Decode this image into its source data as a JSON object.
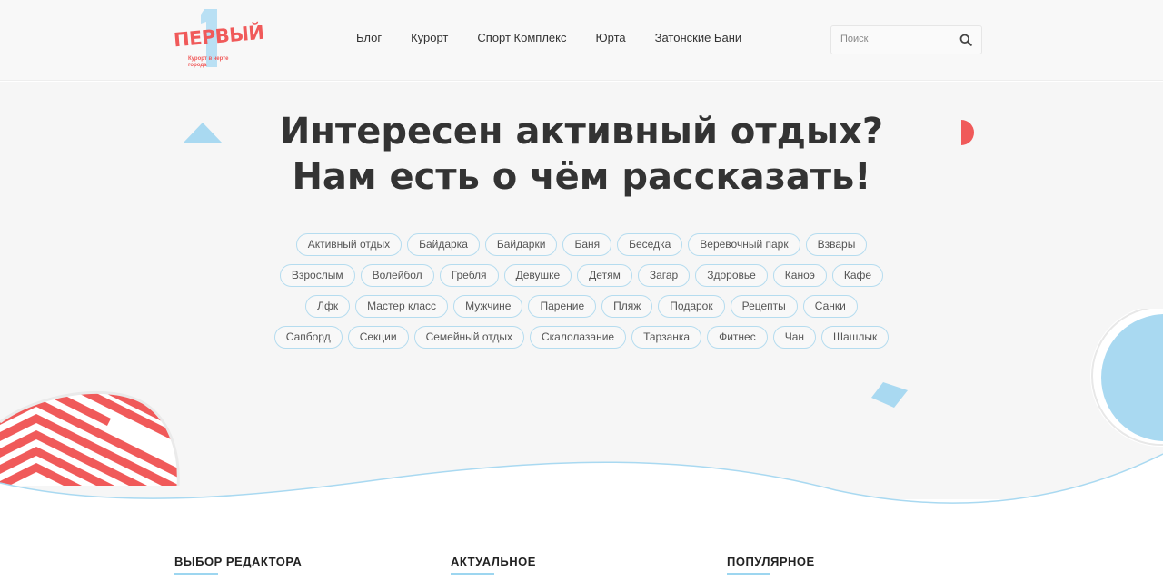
{
  "brand": {
    "logo_word": "ПЕРВЫЙ",
    "logo_tagline": "Курорт в черте города",
    "accent": "#f05a5a",
    "secondary": "#9dd6f0"
  },
  "nav": {
    "items": [
      {
        "label": "Блог"
      },
      {
        "label": "Курорт"
      },
      {
        "label": "Спорт Комплекс"
      },
      {
        "label": "Юрта"
      },
      {
        "label": "Затонские Бани"
      }
    ]
  },
  "search": {
    "placeholder": "Поиск",
    "value": "",
    "icon": "search-icon"
  },
  "hero": {
    "title_line1": "Интересен активный отдых?",
    "title_line2": "Нам есть о чём рассказать!"
  },
  "tags": [
    "Активный отдых",
    "Байдарка",
    "Байдарки",
    "Баня",
    "Беседка",
    "Веревочный парк",
    "Взвары",
    "Взрослым",
    "Волейбол",
    "Гребля",
    "Девушке",
    "Детям",
    "Загар",
    "Здоровье",
    "Каноэ",
    "Кафе",
    "Лфк",
    "Мастер класс",
    "Мужчине",
    "Парение",
    "Пляж",
    "Подарок",
    "Рецепты",
    "Санки",
    "Сапборд",
    "Секции",
    "Семейный отдых",
    "Скалолазание",
    "Тарзанка",
    "Фитнес",
    "Чан",
    "Шашлык"
  ],
  "sections": {
    "editor_choice": "ВЫБОР РЕДАКТОРА",
    "actual": "АКТУАЛЬНОЕ",
    "popular": "ПОПУЛЯРНОЕ"
  }
}
